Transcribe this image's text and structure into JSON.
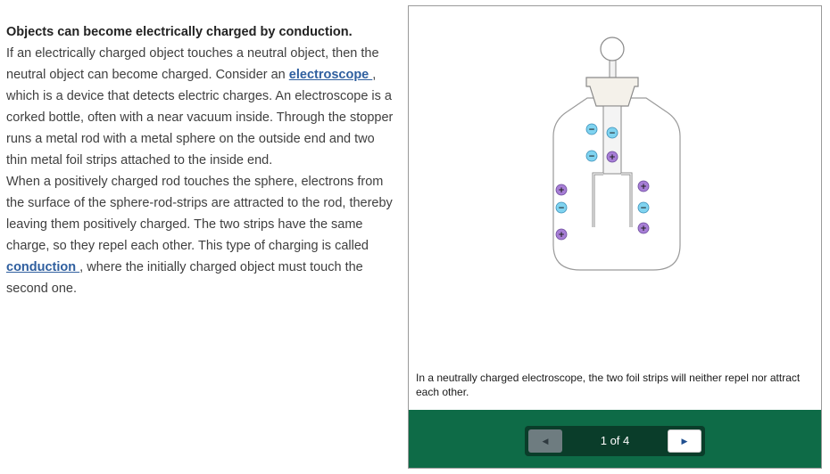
{
  "article": {
    "heading": "Objects can become electrically charged by conduction.",
    "p1_before": "If an electrically charged object touches a neutral object, then the neutral object can become charged. Consider an ",
    "term1": "electroscope ",
    "p1_after": ", which is a device that detects electric charges. An electroscope is a corked bottle, often with a near vacuum inside. Through the stopper runs a metal rod with a metal sphere on the outside end and two thin metal foil strips attached to the inside end.",
    "p2_before": "When a positively charged rod touches the sphere, electrons from the surface of the sphere-rod-strips are attracted to the rod, thereby leaving them positively charged. The two strips have the same charge, so they repel each other. This type of charging is called ",
    "term2": "conduction ",
    "p2_after": ", where the initially charged object must touch the second one."
  },
  "slideshow": {
    "caption": "In a neutrally charged electroscope, the two foil strips will neither repel nor attract each other.",
    "counter": "1 of 4",
    "prev_icon": "triangle-left-icon",
    "next_icon": "triangle-right-icon",
    "colors": {
      "nav_bar": "#0e6b47",
      "negative_charge": "#7fd3f0",
      "positive_charge": "#a77ed6"
    },
    "figure": {
      "charges": [
        {
          "sign": "−"
        },
        {
          "sign": "−"
        },
        {
          "sign": "−"
        },
        {
          "sign": "+"
        },
        {
          "sign": "+"
        },
        {
          "sign": "−"
        },
        {
          "sign": "+"
        },
        {
          "sign": "+"
        },
        {
          "sign": "−"
        },
        {
          "sign": "+"
        }
      ]
    }
  }
}
